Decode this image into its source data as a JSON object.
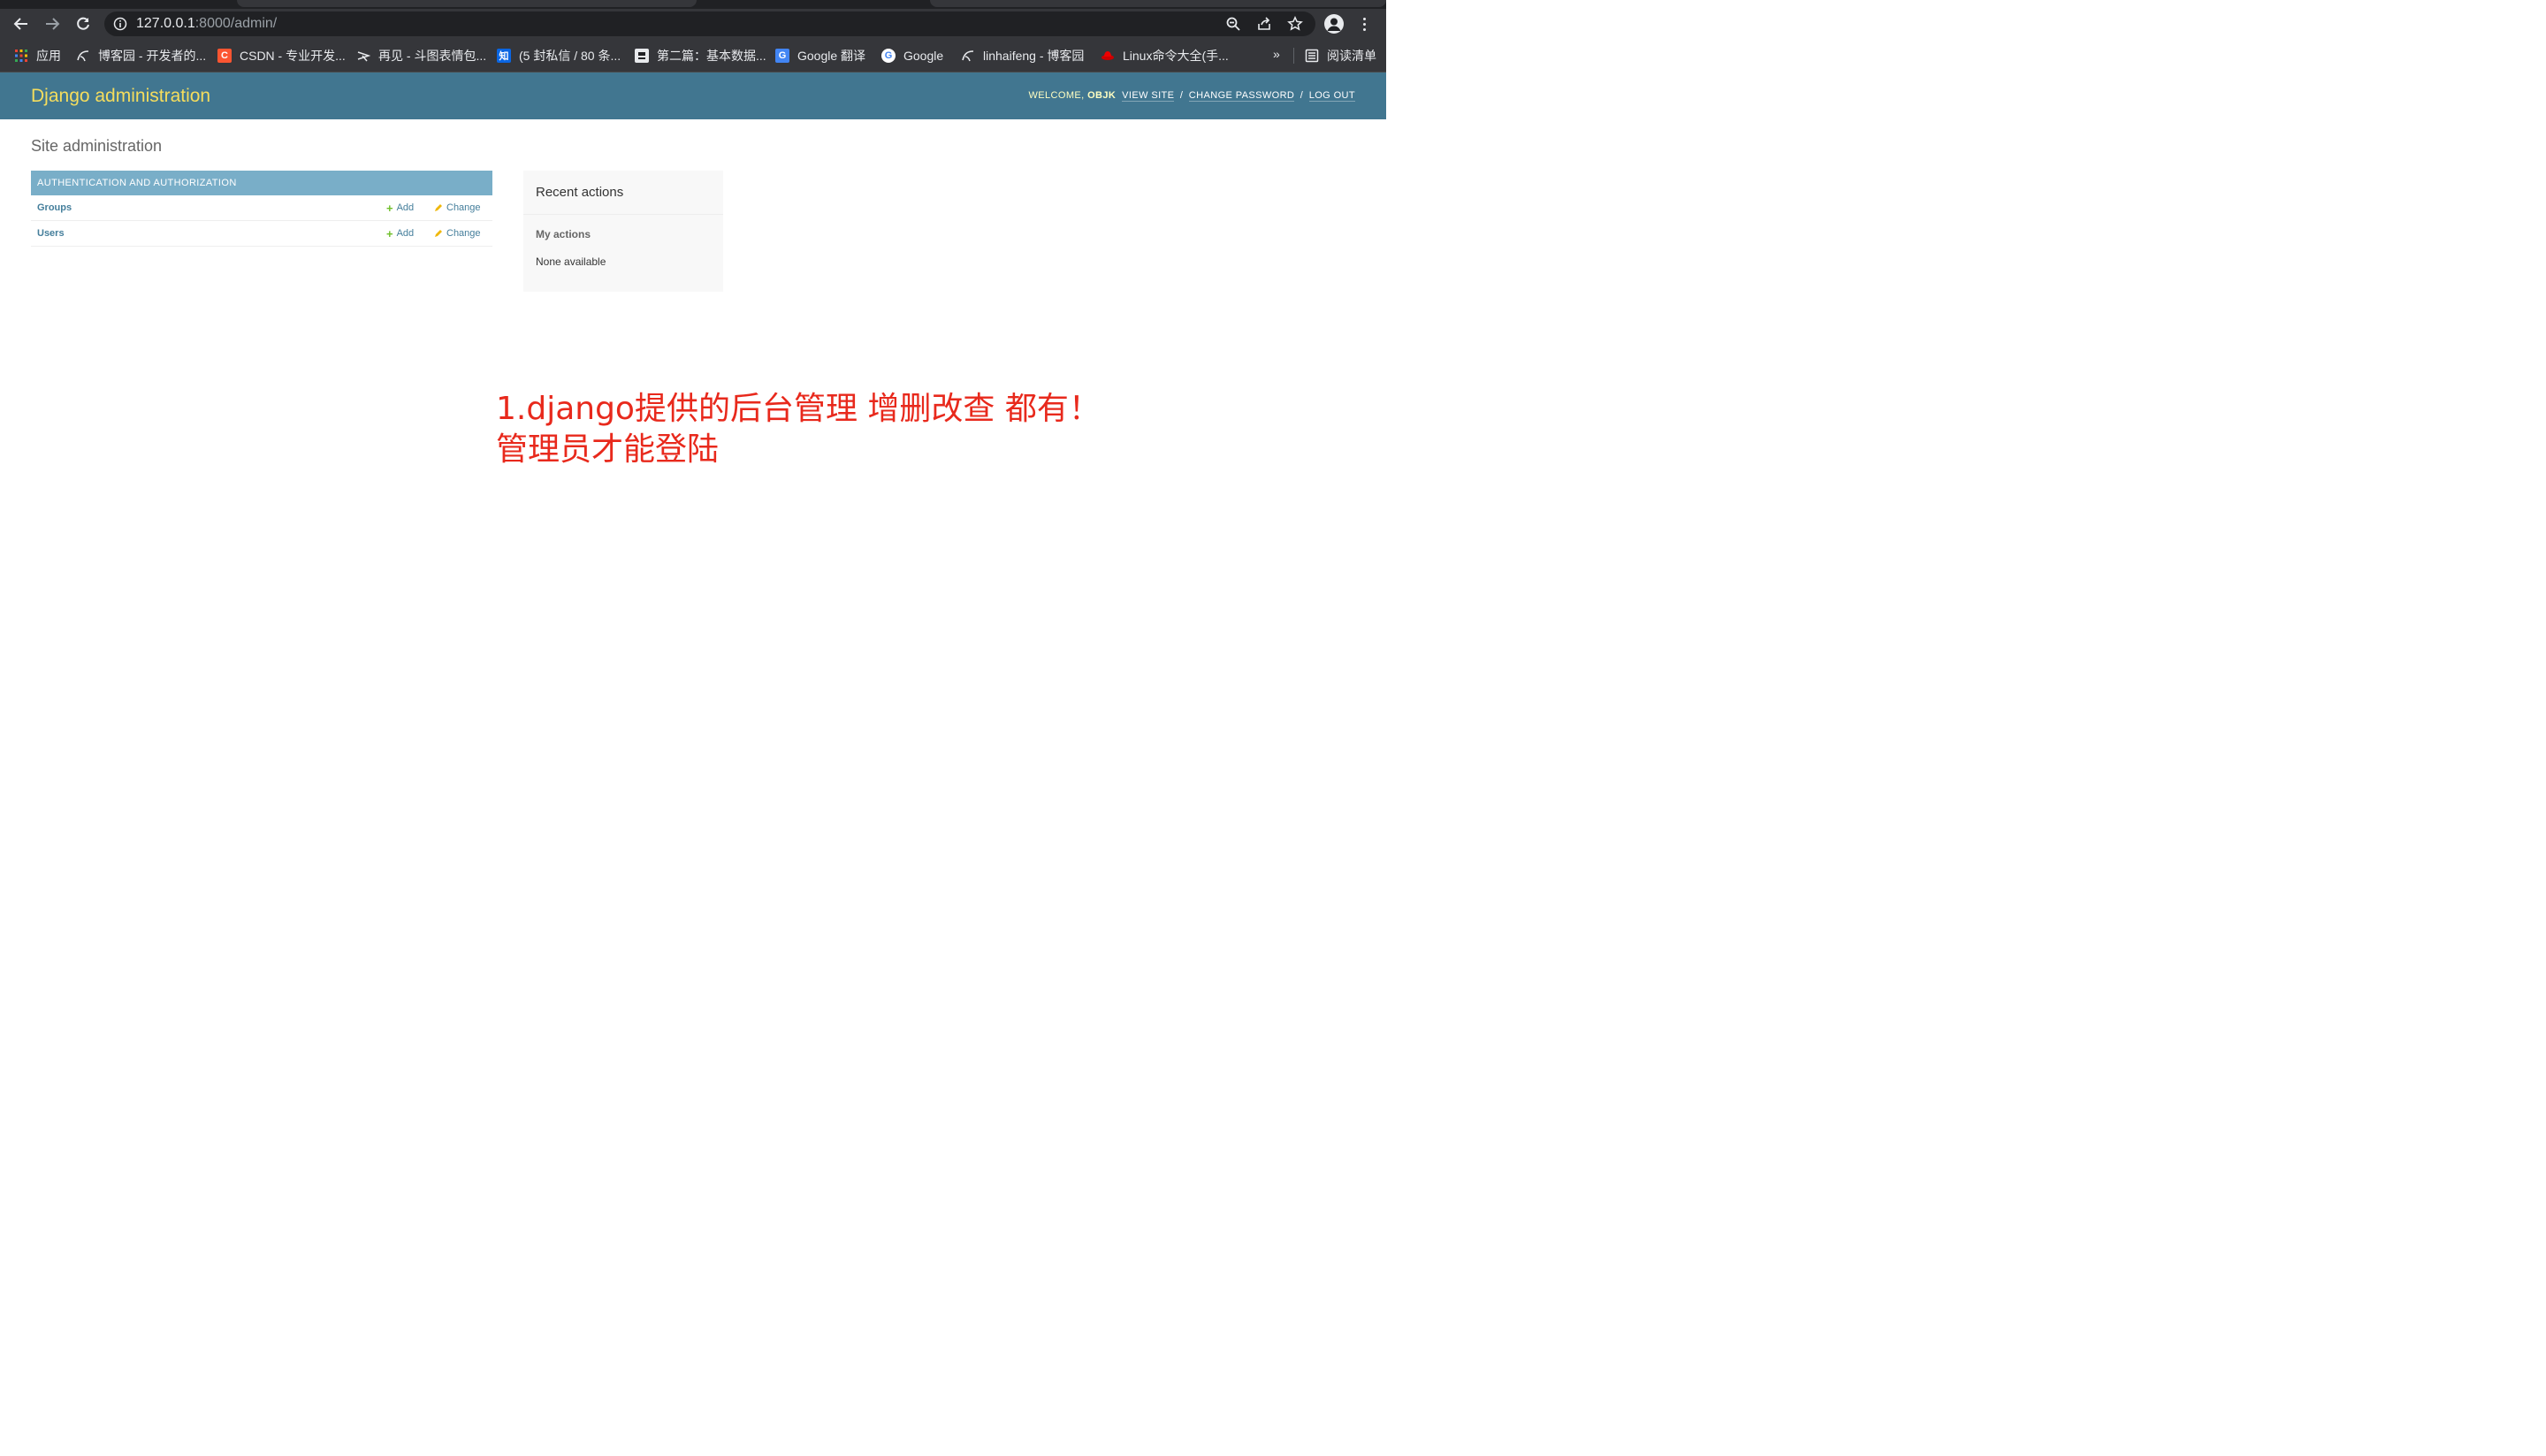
{
  "browser": {
    "url_host": "127.0.0.1",
    "url_rest": ":8000/admin/"
  },
  "bookmarks": [
    {
      "label": "应用",
      "icon": "apps-grid-icon"
    },
    {
      "label": "博客园 - 开发者的...",
      "icon": "cnblogs-icon"
    },
    {
      "label": "CSDN - 专业开发...",
      "icon": "csdn-icon",
      "glyph": "C"
    },
    {
      "label": "再见 - 斗图表情包...",
      "icon": "doutu-icon"
    },
    {
      "label": "(5 封私信 / 80 条...",
      "icon": "zhihu-icon",
      "glyph": "知"
    },
    {
      "label": "第二篇：基本数据...",
      "icon": "page-icon"
    },
    {
      "label": "Google 翻译",
      "icon": "google-translate-icon",
      "glyph": "G"
    },
    {
      "label": "Google",
      "icon": "google-icon",
      "glyph": "G"
    },
    {
      "label": "linhaifeng - 博客园",
      "icon": "cnblogs-icon"
    },
    {
      "label": "Linux命令大全(手...",
      "icon": "redhat-icon"
    }
  ],
  "bookmarks_more": "»",
  "reading_list": "阅读清单",
  "admin": {
    "brand": "Django administration",
    "welcome": "Welcome,",
    "username": "objk",
    "view_site": "View site",
    "change_password": "Change password",
    "log_out": "Log out",
    "separator": "/",
    "page_title": "Site administration",
    "module": {
      "caption": "Authentication and Authorization",
      "rows": [
        {
          "name": "Groups",
          "add": "Add",
          "change": "Change"
        },
        {
          "name": "Users",
          "add": "Add",
          "change": "Change"
        }
      ]
    },
    "recent": {
      "title": "Recent actions",
      "subtitle": "My actions",
      "empty": "None available"
    }
  },
  "annotation": {
    "line1": "1.django提供的后台管理 增删改查 都有！",
    "line2": "管理员才能登陆"
  },
  "colors": {
    "header": "#417690",
    "brand": "#f5dd5d",
    "module_caption": "#79aec8",
    "link": "#447e9b",
    "add_plus": "#70bf2b",
    "annotation": "#e8291c"
  }
}
